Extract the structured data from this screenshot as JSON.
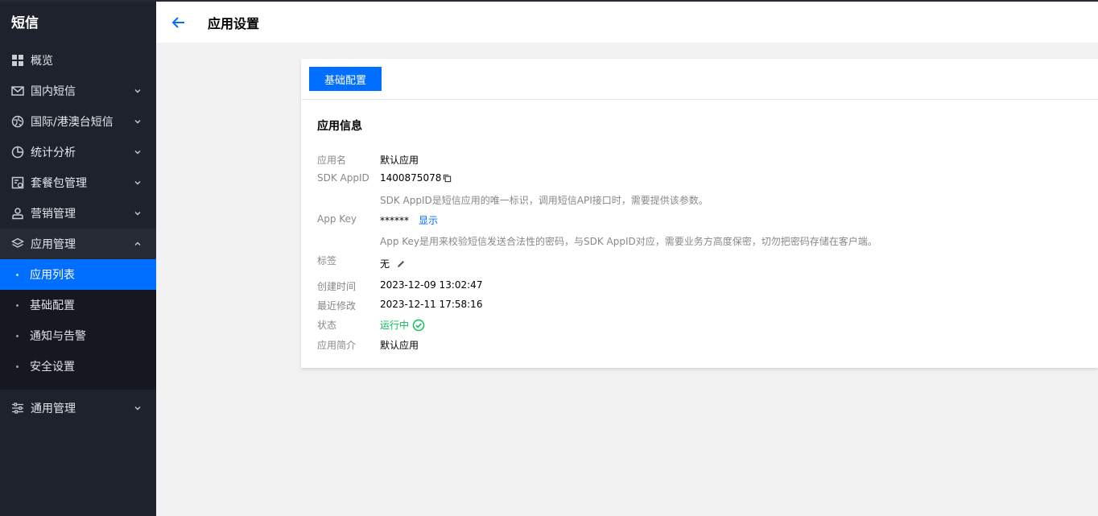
{
  "sidebar": {
    "brand": "短信",
    "items": [
      {
        "label": "概览",
        "icon": "grid-icon"
      },
      {
        "label": "国内短信",
        "icon": "mail-icon"
      },
      {
        "label": "国际/港澳台短信",
        "icon": "globe-icon"
      },
      {
        "label": "统计分析",
        "icon": "pie-chart-icon"
      },
      {
        "label": "套餐包管理",
        "icon": "package-icon"
      },
      {
        "label": "营销管理",
        "icon": "user-icon"
      },
      {
        "label": "应用管理",
        "icon": "layers-icon"
      }
    ],
    "sub_items": [
      {
        "label": "应用列表",
        "active": true
      },
      {
        "label": "基础配置"
      },
      {
        "label": "通知与告警"
      },
      {
        "label": "安全设置"
      }
    ],
    "last_item": {
      "label": "通用管理",
      "icon": "sliders-icon"
    }
  },
  "header": {
    "title": "应用设置"
  },
  "card": {
    "tab": "基础配置",
    "section_title": "应用信息",
    "fields": {
      "app_name": {
        "label": "应用名",
        "value": "默认应用"
      },
      "sdk_appid": {
        "label": "SDK AppID",
        "value": "1400875078",
        "hint": "SDK AppID是短信应用的唯一标识，调用短信API接口时，需要提供该参数。"
      },
      "app_key": {
        "label": "App Key",
        "value": "******",
        "action": "显示",
        "hint": "App Key是用来校验短信发送合法性的密码，与SDK AppID对应，需要业务方高度保密，切勿把密码存储在客户端。"
      },
      "tag": {
        "label": "标签",
        "value": "无"
      },
      "created": {
        "label": "创建时间",
        "value": "2023-12-09 13:02:47"
      },
      "modified": {
        "label": "最近修改",
        "value": "2023-12-11 17:58:16"
      },
      "status": {
        "label": "状态",
        "value": "运行中"
      },
      "intro": {
        "label": "应用简介",
        "value": "默认应用"
      }
    }
  },
  "colors": {
    "sidebar_bg": "#1e222d",
    "accent": "#006eff",
    "status_green": "#0abf5b"
  }
}
